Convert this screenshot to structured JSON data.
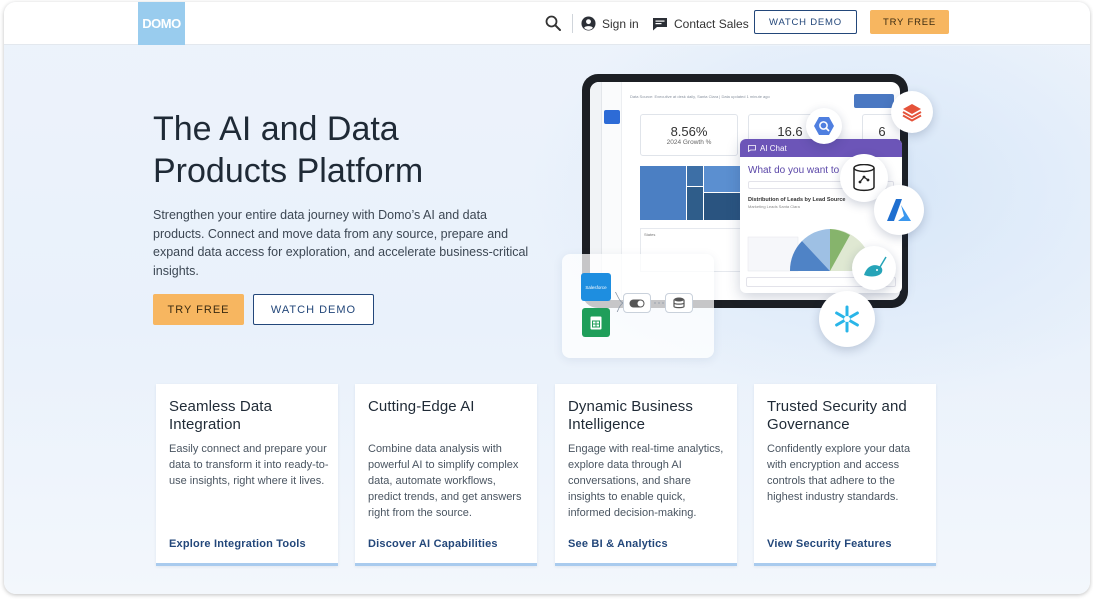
{
  "header": {
    "logo": "DOMO",
    "signin_label": "Sign in",
    "contact_label": "Contact Sales",
    "watch_demo_label": "WATCH DEMO",
    "try_free_label": "TRY FREE"
  },
  "hero": {
    "title_line1": "The AI and Data",
    "title_line2": "Products Platform",
    "subtitle": "Strengthen your entire data journey with Domo’s AI and data products. Connect and move data from any source, prepare and expand data access for exploration, and accelerate business-critical insights.",
    "try_free_label": "TRY FREE",
    "watch_demo_label": "WATCH DEMO"
  },
  "illustration": {
    "kpi1_value": "8.56%",
    "kpi1_label": "2024 Growth %",
    "kpi2_value": "16.6",
    "kpi3_value": "6",
    "chat_header": "AI Chat",
    "chat_question": "What do you want to do today?",
    "chat_chart_title": "Distribution of Leads by Lead Source",
    "chat_chart_sub": "Marketing Leads Santa Clara",
    "states_label": "States",
    "salesforce_label": "Salesforce",
    "data_source_text": "Data Source: Executive at desk daily, Santa Clara | Data updated 1 minute ago",
    "colors": {
      "accent": "#23477a",
      "cta": "#f7b660",
      "chat": "#6c55b8"
    }
  },
  "cards": [
    {
      "title": "Seamless Data Integration",
      "body": "Easily connect and prepare your data to transform it into ready-to-use insights, right where it lives.",
      "link": "Explore Integration Tools"
    },
    {
      "title": "Cutting-Edge AI",
      "body": "Combine data analysis with powerful AI to simplify complex data, automate workflows, predict trends, and get answers right from the source.",
      "link": "Discover AI Capabilities"
    },
    {
      "title": "Dynamic Business Intelligence",
      "body": "Engage with real-time analytics, explore data through AI conversations, and share insights to enable quick, informed decision-making.",
      "link": "See BI & Analytics"
    },
    {
      "title": "Trusted Security and Governance",
      "body": "Confidently explore your data with encryption and access controls that adhere to the highest industry standards.",
      "link": "View Security Features"
    }
  ]
}
